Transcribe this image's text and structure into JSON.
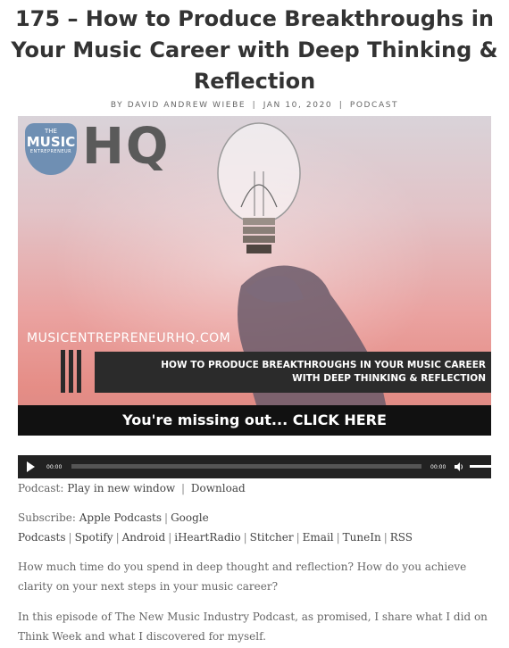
{
  "post": {
    "title": "175 – How to Produce Breakthroughs in Your Music Career with Deep Thinking & Reflection",
    "meta": {
      "by_label": "by",
      "author": "David Andrew Wiebe",
      "date": "Jan 10, 2020",
      "category": "Podcast"
    }
  },
  "hero": {
    "badge_top": "THE",
    "badge_big": "MUSIC",
    "badge_small": "ENTREPRENEUR",
    "hq_text": "HQ",
    "site_url": "MUSICENTREPRENEURHQ.COM",
    "banner_line1": "HOW TO PRODUCE BREAKTHROUGHS IN YOUR MUSIC CAREER",
    "banner_line2": "WITH DEEP THINKING & REFLECTION",
    "cta": "You're missing out... CLICK HERE"
  },
  "player": {
    "current_time": "00:00",
    "duration": "00:00",
    "progress": 0,
    "volume": 1.0
  },
  "podcast_line": {
    "label": "Podcast:",
    "play_new_window": "Play in new window",
    "download": "Download"
  },
  "subscribe": {
    "label": "Subscribe:",
    "links": [
      "Apple Podcasts",
      "Google Podcasts",
      "Spotify",
      "Android",
      "iHeartRadio",
      "Stitcher",
      "Email",
      "TuneIn",
      "RSS"
    ]
  },
  "body": {
    "p1": "How much time do you spend in deep thought and reflection? How do you achieve clarity on your next steps in your music career?",
    "p2": "In this episode of The New Music Industry Podcast, as promised, I share what I did on Think Week and what I discovered for myself."
  },
  "colors": {
    "title": "#333333",
    "text": "#666666",
    "player_bg": "#222222",
    "banner_bg": "#2b2b2b"
  }
}
